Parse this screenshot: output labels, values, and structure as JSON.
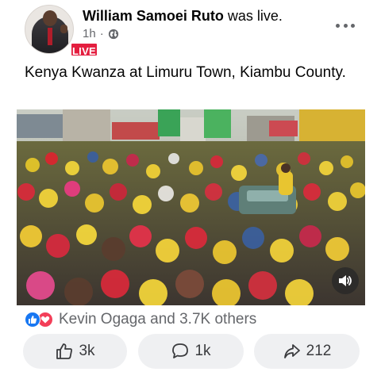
{
  "post": {
    "author": "William Samoei Ruto",
    "action": "was live.",
    "time": "1h",
    "separator": "·",
    "privacy_icon": "globe-icon",
    "live_badge": "LIVE",
    "text": "Kenya Kwanza at Limuru Town, Kiambu County.",
    "more_icon": "more-options-icon"
  },
  "video": {
    "description_icon": "volume-icon"
  },
  "reactions": {
    "icons": [
      "like-reaction-icon",
      "love-reaction-icon"
    ],
    "summary": "Kevin Ogaga and 3.7K others"
  },
  "actions": {
    "like_count": "3k",
    "comment_count": "1k",
    "share_count": "212"
  },
  "colors": {
    "live_red": "#e41e3f",
    "like_blue": "#1877f2",
    "love_red": "#f33e58",
    "button_bg": "#eff0f2",
    "secondary_text": "#65676b"
  }
}
